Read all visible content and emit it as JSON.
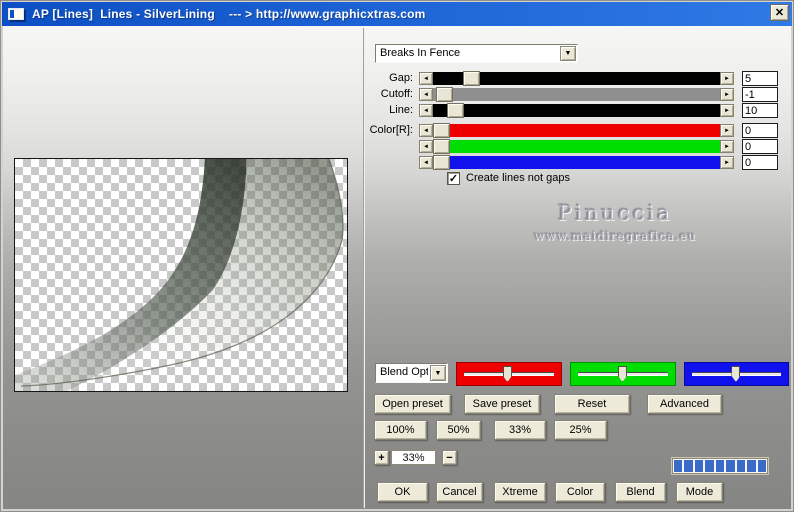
{
  "window": {
    "title": "AP [Lines]  Lines - SilverLining    --- > http://www.graphicxtras.com"
  },
  "icons": {
    "close": "✕",
    "left_arrow": "◄",
    "right_arrow": "►",
    "down_arrow": "▼",
    "check": "✓"
  },
  "colors": {
    "titlebar_left": "#0d4fc4",
    "titlebar_right": "#2f7ae6",
    "progress": "#3a6bc8"
  },
  "preset": {
    "value": "Breaks In Fence"
  },
  "sliders": [
    {
      "label": "Gap:",
      "value": "5",
      "track_color": "#000000",
      "thumb_pct": 10.5
    },
    {
      "label": "Cutoff:",
      "value": "-1",
      "track_color": "#8f8f8f",
      "thumb_pct": 1
    },
    {
      "label": "Line:",
      "value": "10",
      "track_color": "#000000",
      "thumb_pct": 5
    },
    {
      "label": "Color[R]:",
      "value": "0",
      "track_color": "#ee0000",
      "thumb_pct": 0
    },
    {
      "label": "",
      "value": "0",
      "track_color": "#00dd00",
      "thumb_pct": 0
    },
    {
      "label": "",
      "value": "0",
      "track_color": "#1111ee",
      "thumb_pct": 0
    }
  ],
  "checkbox": {
    "label": "Create lines not gaps",
    "checked": true
  },
  "watermark": {
    "line1": "Pinuccia",
    "line2": "www.maidiregrafica.eu"
  },
  "blend": {
    "dropdown_value": "Blend Opti",
    "channels": [
      {
        "name": "red",
        "color": "#ee0000",
        "thumb_pct": 48
      },
      {
        "name": "green",
        "color": "#00dd00",
        "thumb_pct": 49
      },
      {
        "name": "blue",
        "color": "#1111ee",
        "thumb_pct": 49
      }
    ]
  },
  "preset_buttons": [
    "Open preset",
    "Save preset",
    "Reset",
    "Advanced"
  ],
  "zoom_buttons": [
    "100%",
    "50%",
    "33%",
    "25%"
  ],
  "stepper": {
    "plus": "+",
    "value": "33%",
    "minus": "−"
  },
  "progress": {
    "segments": 9
  },
  "action_buttons": [
    "OK",
    "Cancel",
    "Xtreme",
    "Color",
    "Blend",
    "Mode"
  ]
}
